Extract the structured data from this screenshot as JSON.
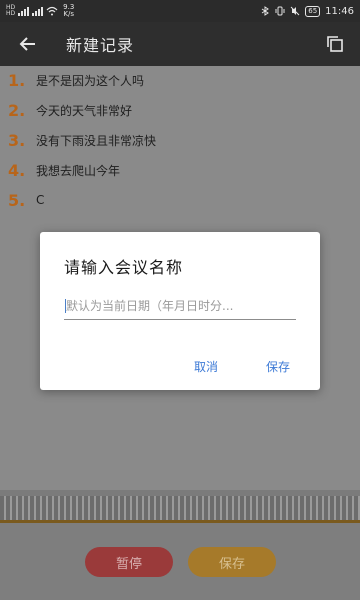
{
  "status_bar": {
    "sim1_label": "HD",
    "sim2_label": "HD",
    "net_speed_value": "9.3",
    "net_speed_unit": "K/s",
    "battery": "65",
    "time": "11:46"
  },
  "app_bar": {
    "title": "新建记录",
    "back_icon": "arrow-left-icon",
    "copy_icon": "copy-icon"
  },
  "lines": [
    {
      "num": "1.",
      "text": "是不是因为这个人吗"
    },
    {
      "num": "2.",
      "text": "今天的天气非常好"
    },
    {
      "num": "3.",
      "text": "没有下雨没且非常凉快"
    },
    {
      "num": "4.",
      "text": "我想去爬山今年"
    },
    {
      "num": "5.",
      "text": "C"
    }
  ],
  "dialog": {
    "title": "请输入会议名称",
    "input_value": "",
    "input_placeholder": "默认为当前日期（年月日时分...",
    "cancel_label": "取消",
    "save_label": "保存"
  },
  "bottom": {
    "pause_label": "暂停",
    "save_label": "保存"
  },
  "colors": {
    "accent_number": "#b8651a",
    "dialog_button": "#3d7ad6",
    "pause_button": "#9a3a3a",
    "save_button": "#a67a2a"
  }
}
